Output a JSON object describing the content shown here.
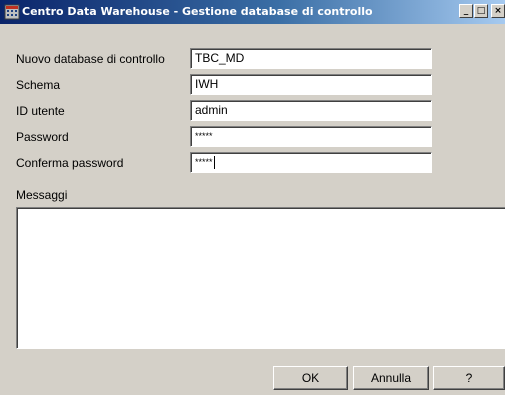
{
  "window": {
    "title": "Centro Data Warehouse - Gestione database di controllo",
    "controls": {
      "minimize": "_",
      "maximize": "□",
      "close": "×"
    }
  },
  "form": {
    "control_db_label": "Nuovo database di controllo",
    "control_db_value": "TBC_MD",
    "schema_label": "Schema",
    "schema_value": "IWH",
    "user_id_label": "ID utente",
    "user_id_value": "admin",
    "password_label": "Password",
    "password_value": "*****",
    "confirm_password_label": "Conferma password",
    "confirm_password_value": "*****"
  },
  "messages": {
    "label": "Messaggi",
    "content": ""
  },
  "buttons": {
    "ok": "OK",
    "cancel": "Annulla",
    "help": "?"
  },
  "colors": {
    "title_gradient_start": "#0a246a",
    "title_gradient_end": "#a6caf0",
    "window_bg": "#d4d0c8"
  },
  "icons": {
    "app": "dwc-app-icon"
  }
}
